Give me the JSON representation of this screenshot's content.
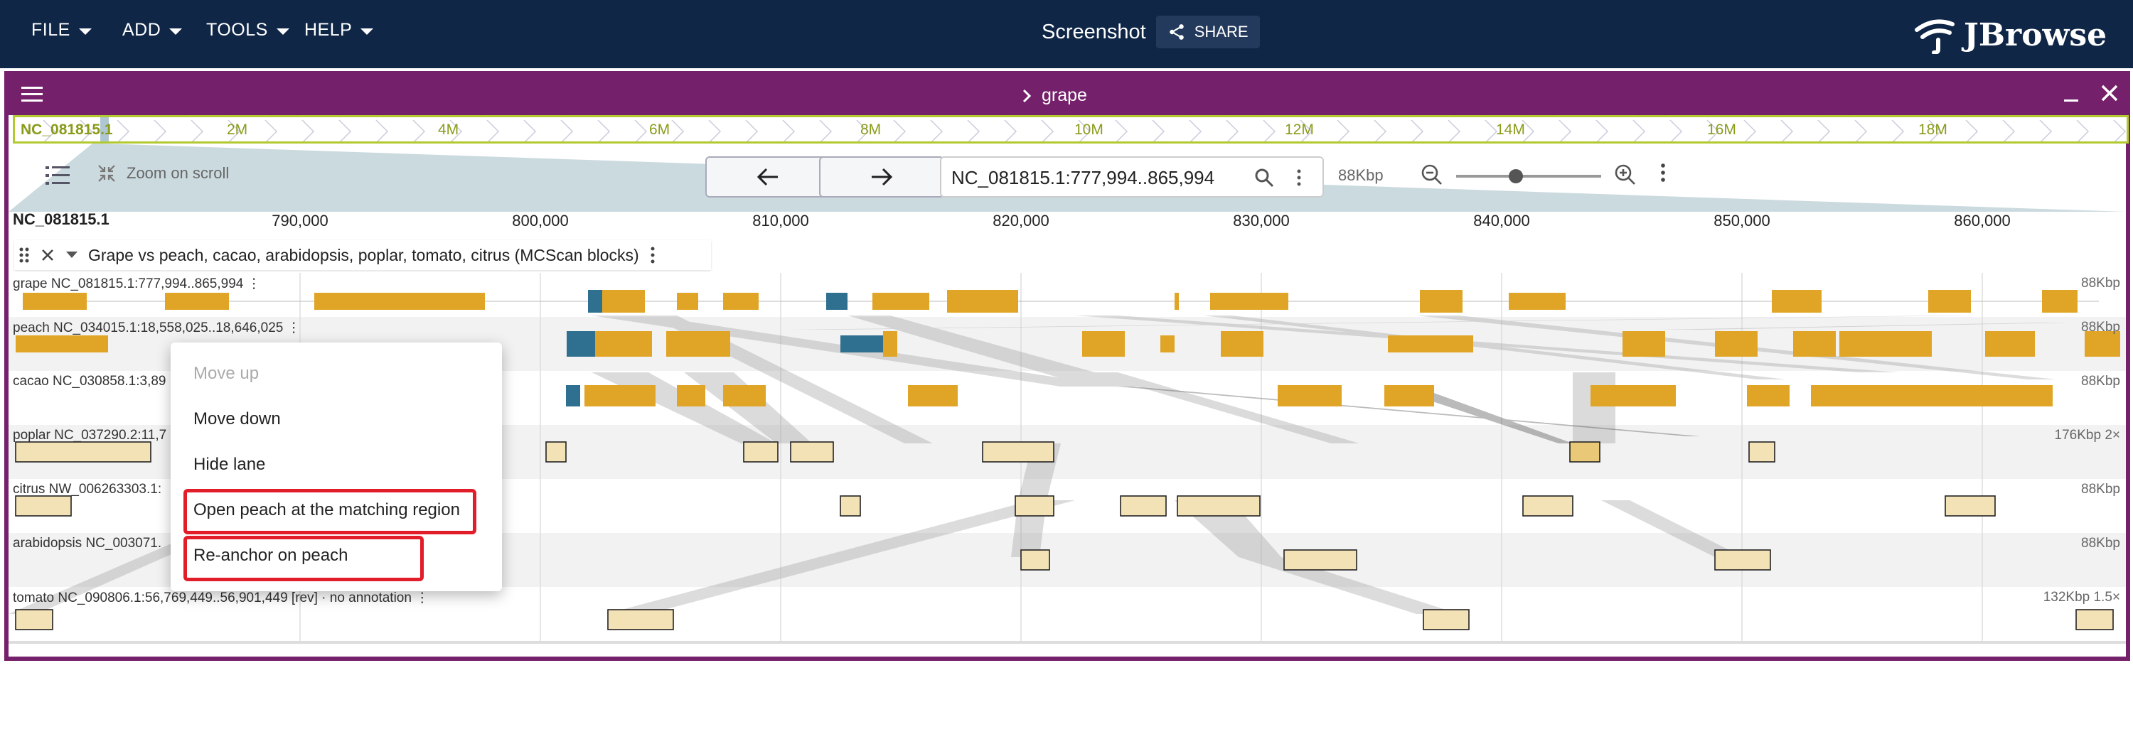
{
  "appbar": {
    "menus": [
      "FILE",
      "ADD",
      "TOOLS",
      "HELP"
    ],
    "session_title": "Screenshot",
    "share_label": "SHARE",
    "logo_text": "JBrowse",
    "logo_icon": "jbrowse-logo-icon"
  },
  "view": {
    "name": "grape",
    "overview": {
      "chromosome": "NC_081815.1",
      "labels": [
        "2M",
        "4M",
        "6M",
        "8M",
        "10M",
        "12M",
        "14M",
        "16M",
        "18M"
      ]
    },
    "controls": {
      "zoom_on_scroll": "Zoom on scroll",
      "location": "NC_081815.1:777,994..865,994",
      "bp_width": "88Kbp"
    },
    "ruler": {
      "chromosome": "NC_081815.1",
      "ticks": [
        "790,000",
        "800,000",
        "810,000",
        "820,000",
        "830,000",
        "840,000",
        "850,000",
        "860,000"
      ]
    },
    "synteny_track": {
      "title": "Grape vs peach, cacao, arabidopsis, poplar, tomato, citrus (MCScan blocks)"
    },
    "lanes": [
      {
        "label": "grape NC_081815.1:777,994..865,994 ⋮",
        "right": "88Kbp"
      },
      {
        "label": "peach NC_034015.1:18,558,025..18,646,025 ⋮",
        "right": "88Kbp"
      },
      {
        "label": "cacao NC_030858.1:3,89",
        "right": "88Kbp"
      },
      {
        "label": "poplar NC_037290.2:11,7",
        "right": "176Kbp 2×"
      },
      {
        "label": "citrus NW_006263303.1:",
        "right": "88Kbp"
      },
      {
        "label": "arabidopsis NC_003071.",
        "right": "88Kbp"
      },
      {
        "label": "tomato NC_090806.1:56,769,449..56,901,449 [rev] · no annotation ⋮",
        "right": "132Kbp 1.5×"
      }
    ]
  },
  "context_menu": {
    "items": [
      {
        "label": "Move up",
        "disabled": true
      },
      {
        "label": "Move down",
        "disabled": false
      },
      {
        "label": "Hide lane",
        "disabled": false
      },
      {
        "label": "Open peach at the matching region",
        "disabled": false,
        "highlighted": true
      },
      {
        "label": "Re-anchor on peach",
        "disabled": false,
        "highlighted": true
      }
    ]
  },
  "colors": {
    "appbar": "#0f2647",
    "view_border": "#74206a",
    "gene_cds": "#e0a526",
    "gene_utr": "#2f6f8f",
    "block_fill": "#f3e2b6",
    "highlight": "#e21d2a"
  }
}
